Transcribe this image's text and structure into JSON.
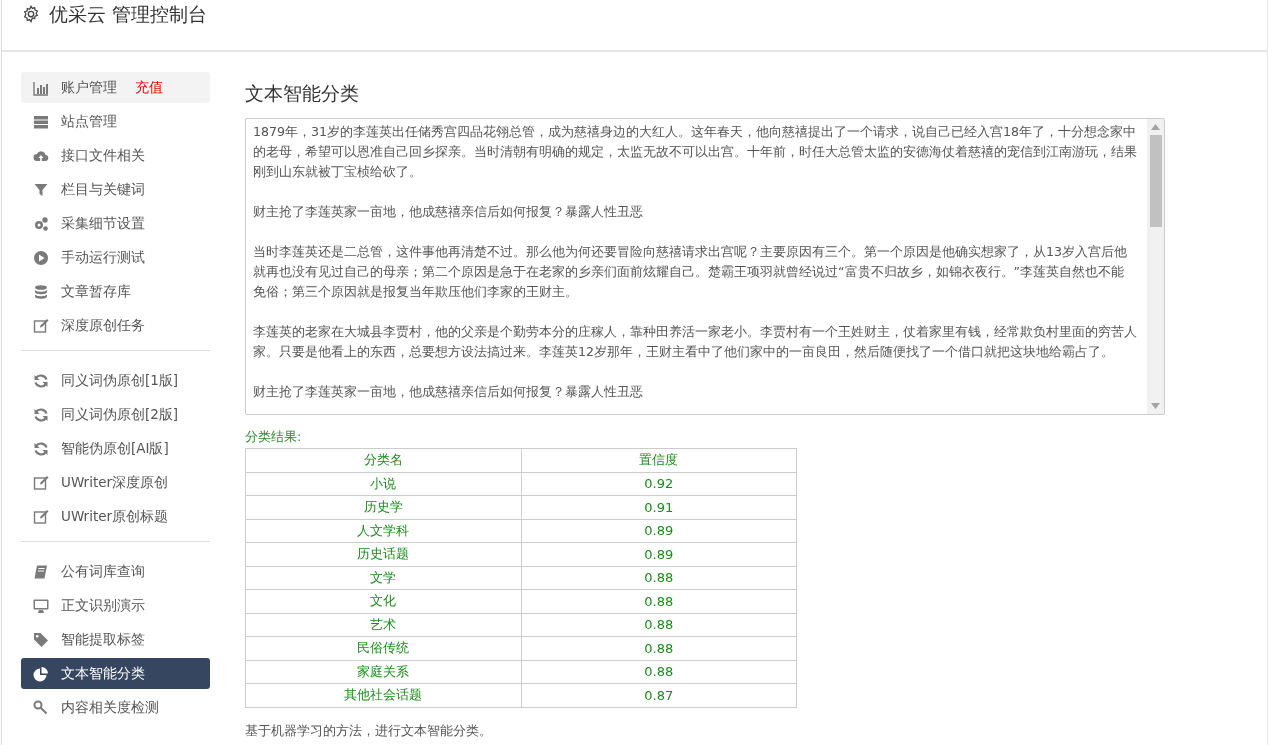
{
  "header": {
    "title": "优采云 管理控制台"
  },
  "sidebar": {
    "groups": [
      {
        "items": [
          {
            "label": "账户管理",
            "badge": "充值",
            "selected": false,
            "hovered": true
          },
          {
            "label": "站点管理",
            "selected": false,
            "hovered": false
          },
          {
            "label": "接口文件相关",
            "selected": false,
            "hovered": false
          },
          {
            "label": "栏目与关键词",
            "selected": false,
            "hovered": false
          },
          {
            "label": "采集细节设置",
            "selected": false,
            "hovered": false
          },
          {
            "label": "手动运行测试",
            "selected": false,
            "hovered": false
          },
          {
            "label": "文章暂存库",
            "selected": false,
            "hovered": false
          },
          {
            "label": "深度原创任务",
            "selected": false,
            "hovered": false
          }
        ]
      },
      {
        "items": [
          {
            "label": "同义词伪原创[1版]",
            "selected": false,
            "hovered": false
          },
          {
            "label": "同义词伪原创[2版]",
            "selected": false,
            "hovered": false
          },
          {
            "label": "智能伪原创[AI版]",
            "selected": false,
            "hovered": false
          },
          {
            "label": "UWriter深度原创",
            "selected": false,
            "hovered": false
          },
          {
            "label": "UWriter原创标题",
            "selected": false,
            "hovered": false
          }
        ]
      },
      {
        "items": [
          {
            "label": "公有词库查询",
            "selected": false,
            "hovered": false
          },
          {
            "label": "正文识别演示",
            "selected": false,
            "hovered": false
          },
          {
            "label": "智能提取标签",
            "selected": false,
            "hovered": false
          },
          {
            "label": "文本智能分类",
            "selected": true,
            "hovered": false
          },
          {
            "label": "内容相关度检测",
            "selected": false,
            "hovered": false
          }
        ]
      }
    ]
  },
  "main": {
    "title": "文本智能分类",
    "text_area": {
      "paragraphs": [
        "1879年，31岁的李莲英出任储秀宫四品花翎总管，成为慈禧身边的大红人。这年春天，他向慈禧提出了一个请求，说自己已经入宫18年了，十分想念家中的老母，希望可以恩准自己回乡探亲。当时清朝有明确的规定，太监无故不可以出宫。十年前，时任大总管太监的安德海仗着慈禧的宠信到江南游玩，结果刚到山东就被丁宝桢给砍了。",
        "财主抢了李莲英家一亩地，他成慈禧亲信后如何报复？暴露人性丑恶",
        "当时李莲英还是二总管，这件事他再清楚不过。那么他为何还要冒险向慈禧请求出宫呢？主要原因有三个。第一个原因是他确实想家了，从13岁入宫后他就再也没有见过自己的母亲；第二个原因是急于在老家的乡亲们面前炫耀自己。楚霸王项羽就曾经说过“富贵不归故乡，如锦衣夜行。”李莲英自然也不能免俗；第三个原因就是报复当年欺压他们李家的王财主。",
        "李莲英的老家在大城县李贾村，他的父亲是个勤劳本分的庄稼人，靠种田养活一家老小。李贾村有一个王姓财主，仗着家里有钱，经常欺负村里面的穷苦人家。只要是他看上的东西，总要想方设法搞过来。李莲英12岁那年，王财主看中了他们家中的一亩良田，然后随便找了一个借口就把这块地给霸占了。",
        "财主抢了李莲英家一亩地，他成慈禧亲信后如何报复？暴露人性丑恶"
      ]
    },
    "result_label": "分类结果:",
    "table": {
      "columns": [
        "分类名",
        "置信度"
      ],
      "rows": [
        [
          "小说",
          "0.92"
        ],
        [
          "历史学",
          "0.91"
        ],
        [
          "人文学科",
          "0.89"
        ],
        [
          "历史话题",
          "0.89"
        ],
        [
          "文学",
          "0.88"
        ],
        [
          "文化",
          "0.88"
        ],
        [
          "艺术",
          "0.88"
        ],
        [
          "民俗传统",
          "0.88"
        ],
        [
          "家庭关系",
          "0.88"
        ],
        [
          "其他社会话题",
          "0.87"
        ]
      ]
    },
    "note": "基于机器学习的方法，进行文本智能分类。"
  }
}
